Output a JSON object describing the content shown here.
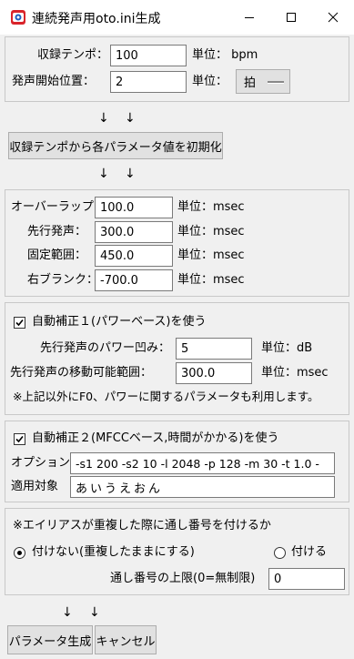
{
  "window": {
    "title": "連続発声用oto.ini生成"
  },
  "recording": {
    "tempo_label": "収録テンポ：",
    "tempo_value": "100",
    "tempo_unit": "単位：  bpm",
    "start_label": "発声開始位置：",
    "start_value": "2",
    "start_unit": "単位：",
    "start_unit_select": "拍"
  },
  "arrows": {
    "down": "↓"
  },
  "init_button": "収録テンポから各パラメータ値を初期化",
  "params": {
    "overlap_label": "オーバーラップ：",
    "overlap_value": "100.0",
    "preutterance_label": "先行発声：",
    "preutterance_value": "300.0",
    "fixed_label": "固定範囲：",
    "fixed_value": "450.0",
    "blank_label": "右ブランク：",
    "blank_value": "-700.0",
    "unit_msec": "単位：msec"
  },
  "auto1": {
    "checkbox_label": "自動補正１(パワーベース)を使う",
    "power_dip_label": "先行発声のパワー凹み：",
    "power_dip_value": "5",
    "power_dip_unit": "単位：dB",
    "movable_label": "先行発声の移動可能範囲：",
    "movable_value": "300.0",
    "movable_unit": "単位：msec",
    "note": "※上記以外にF0、パワーに関するパラメータも利用します。",
    "checked": true
  },
  "auto2": {
    "checkbox_label": "自動補正２(MFCCベース,時間がかかる)を使う",
    "option_label": "オプション",
    "option_value": "-s1 200 -s2 10 -l 2048 -p 128 -m 30 -t 1.0 -",
    "target_label": "適用対象",
    "target_value": "あいうえおん",
    "checked": true
  },
  "alias": {
    "heading": "※エイリアスが重複した際に通し番号を付けるか",
    "radio_no": "付けない(重複したままにする)",
    "radio_yes": "付ける",
    "selected": "no",
    "limit_label": "通し番号の上限(0=無制限)",
    "limit_value": "0"
  },
  "footer": {
    "generate_button": "パラメータ生成",
    "cancel_button": "キャンセル"
  },
  "colors": {
    "window_bg": "#f0f0f0",
    "titlebar_bg": "#ffffff",
    "group_border": "#c8c8c8",
    "input_border": "#7a7a7a",
    "button_bg": "#e1e1e1",
    "icon_red": "#d9242b",
    "icon_blue": "#1f5fbf"
  }
}
